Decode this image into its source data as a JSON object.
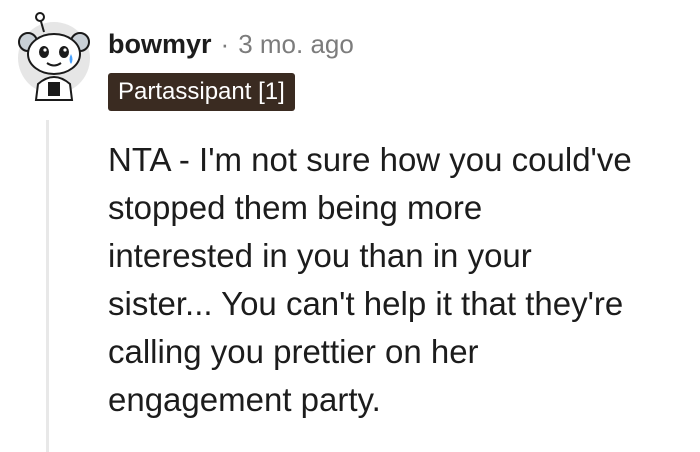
{
  "comment": {
    "username": "bowmyr",
    "separator": "·",
    "timestamp": "3 mo. ago",
    "avatar_icon": "reddit-snoo-avatar-icon",
    "flair": "Partassipant [1]",
    "flair_color": "#3a2b21",
    "text_lines": [
      "NTA - I'm not sure how you could've",
      "stopped them being more",
      "interested in you than in your",
      "sister... You can't help it that they're",
      "calling you prettier on her",
      "engagement party."
    ]
  }
}
